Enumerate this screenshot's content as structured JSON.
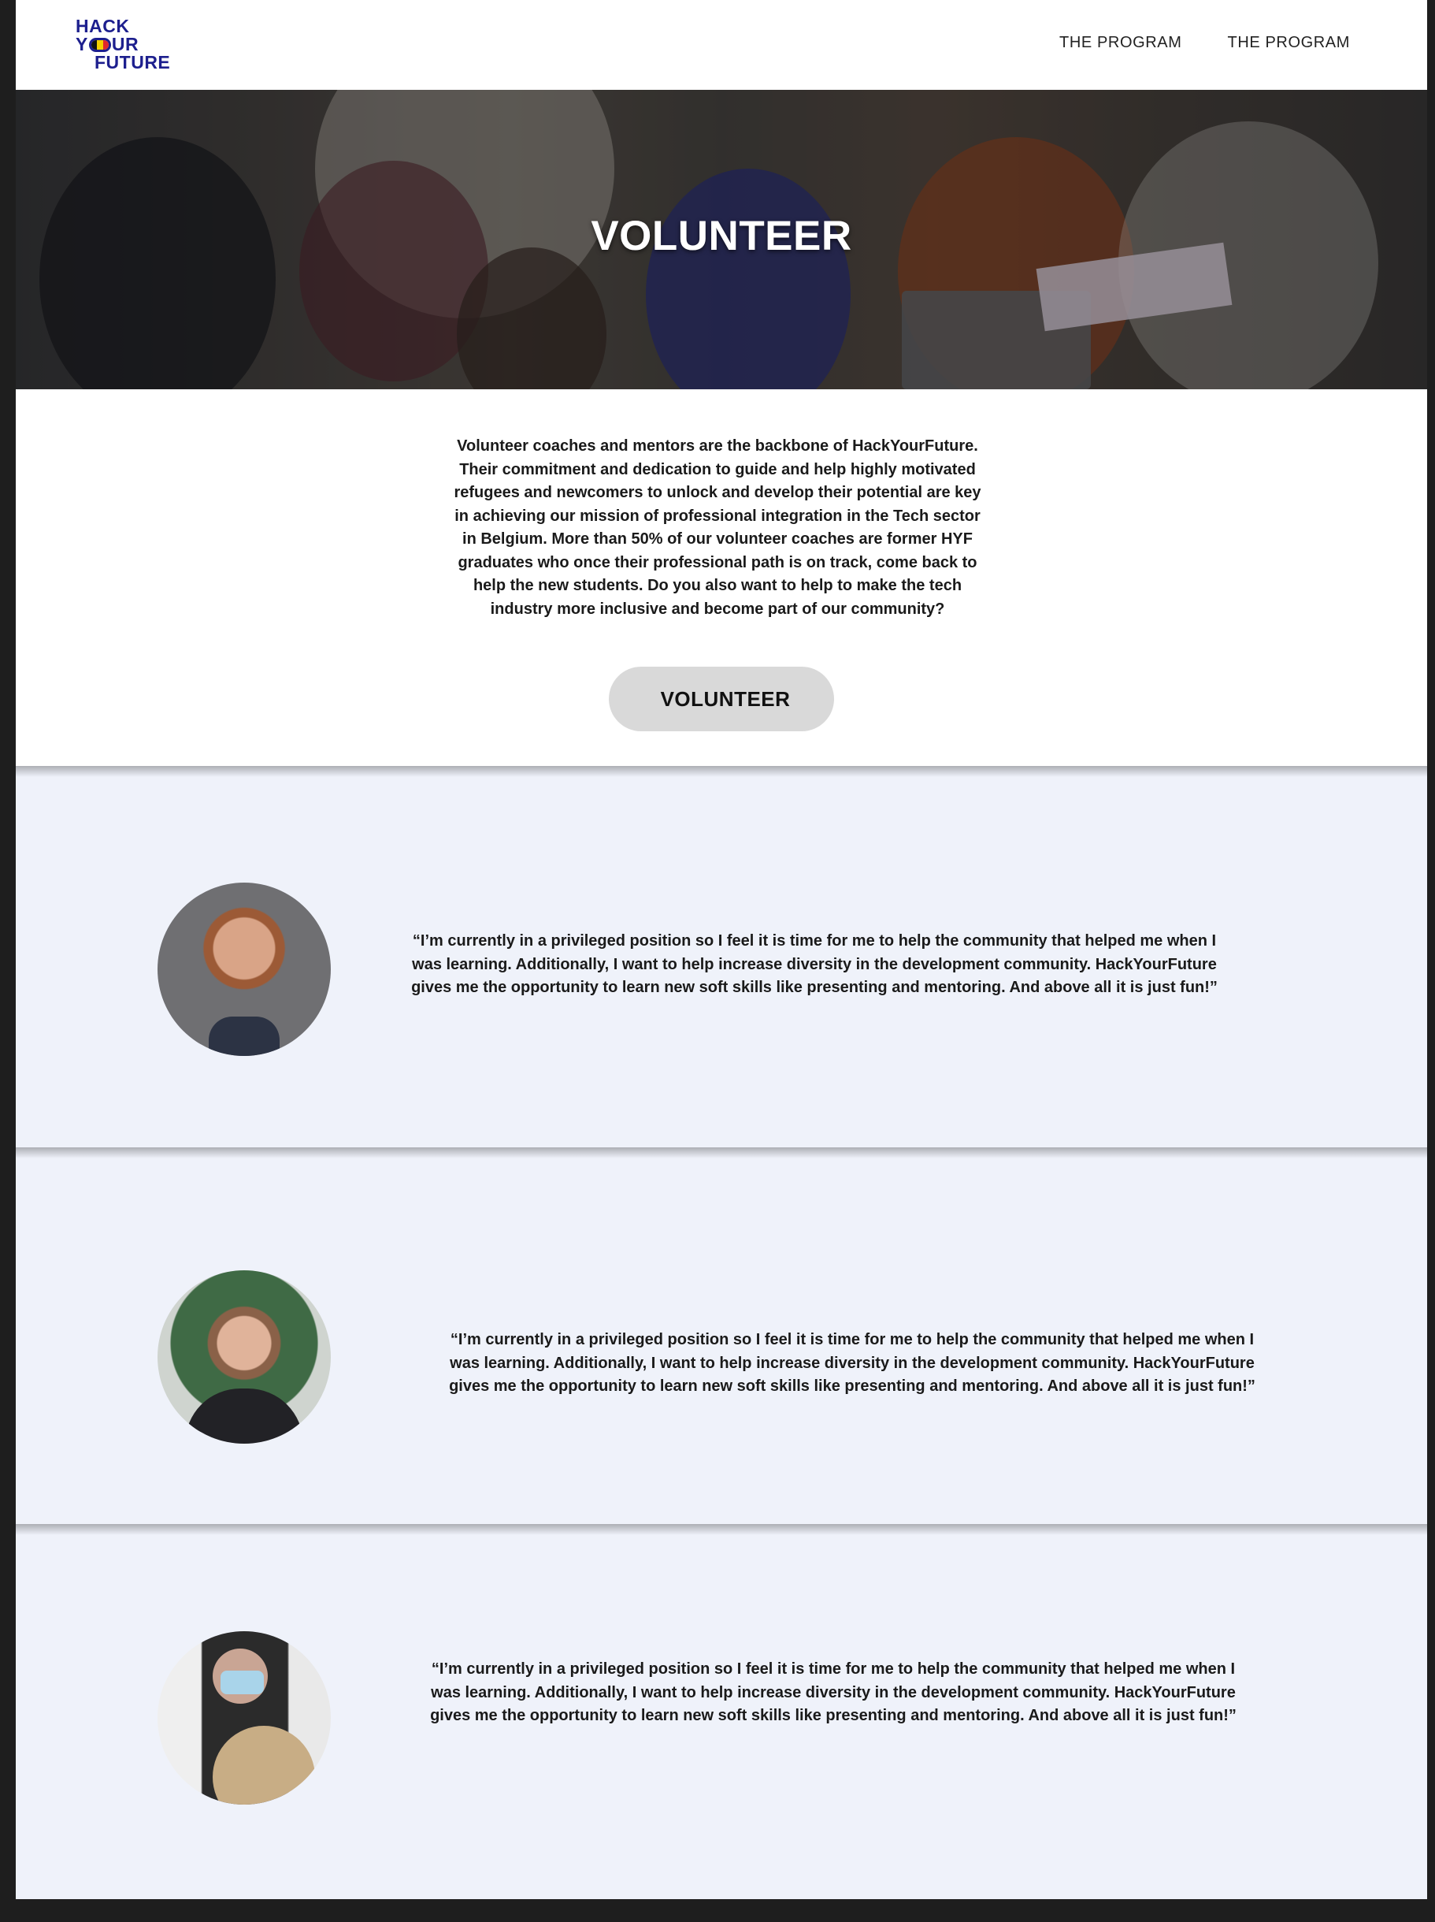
{
  "header": {
    "logo_lines": [
      "HACK",
      "Y",
      "UR",
      "FUTURE"
    ],
    "nav": [
      "THE PROGRAM",
      "THE PROGRAM"
    ]
  },
  "hero": {
    "title": "VOLUNTEER"
  },
  "intro": {
    "text": "Volunteer coaches and mentors are the backbone of HackYourFuture. Their commitment and dedication to guide and help highly motivated refugees and newcomers to unlock and develop their potential are key in achieving our mission of professional integration in the Tech sector in Belgium. More than 50% of our volunteer coaches are former HYF graduates who once their professional path is on track, come back to help the new students. Do you also want to help to make the tech industry more inclusive and become part of our community?",
    "button_label": "VOLUNTEER"
  },
  "testimonials": [
    {
      "quote": "“I’m currently in a privileged position so I feel it is time for me to help the community that helped me when I was learning. Additionally, I want to help increase diversity in the development community. HackYourFuture gives me the opportunity to learn new soft skills like presenting and mentoring. And above all it is just fun!”"
    },
    {
      "quote": "“I’m currently in a privileged position so I feel it is time for me to help the community that helped me when I was learning. Additionally, I want to help increase diversity in the development community. HackYourFuture gives me the opportunity to learn new soft skills like presenting and mentoring. And above all it is just fun!”"
    },
    {
      "quote": "“I’m currently in a privileged position so I feel it is time for me to help the community that helped me when I was learning. Additionally, I want to help increase diversity in the development community. HackYourFuture gives me the opportunity to learn new soft skills like presenting and mentoring. And above all it is just fun!”"
    }
  ],
  "colors": {
    "brand": "#1d1f8e",
    "testimonial_bg": "#eff2fa",
    "button_bg": "#d9d9d9",
    "flag": [
      "#111111",
      "#f5d000",
      "#e0262b"
    ]
  }
}
